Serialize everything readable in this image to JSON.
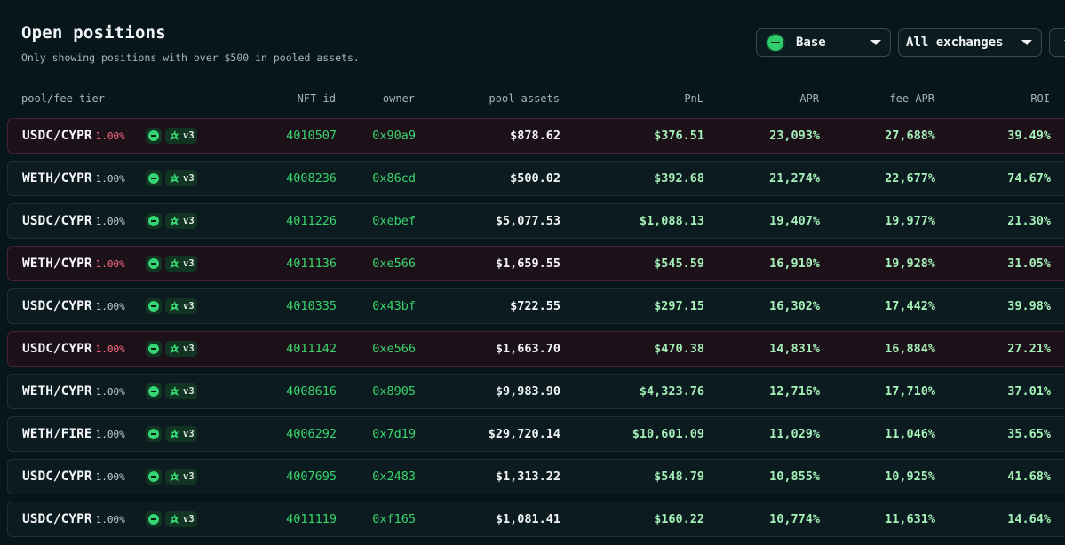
{
  "header": {
    "title": "Open positions",
    "subtitle": "Only showing positions with over $500 in pooled assets."
  },
  "filters": {
    "chain": "Base",
    "exchange": "All exchanges"
  },
  "colors": {
    "background": "#07161a",
    "accent_green": "#39d46b",
    "value_green": "#a6f0b8",
    "fee_red": "#ff6b86",
    "highlight_row": "#1d1119"
  },
  "table": {
    "columns": [
      "pool/fee tier",
      "NFT id",
      "owner",
      "pool assets",
      "PnL",
      "APR",
      "fee APR",
      "ROI"
    ],
    "rows": [
      {
        "pair": "USDC/CYPR",
        "fee": "1.00%",
        "version": "v3",
        "nft_id": "4010507",
        "owner": "0x90a9",
        "pool_assets": "$878.62",
        "pnl": "$376.51",
        "apr": "23,093%",
        "fee_apr": "27,688%",
        "roi": "39.49%",
        "highlighted": true
      },
      {
        "pair": "WETH/CYPR",
        "fee": "1.00%",
        "version": "v3",
        "nft_id": "4008236",
        "owner": "0x86cd",
        "pool_assets": "$500.02",
        "pnl": "$392.68",
        "apr": "21,274%",
        "fee_apr": "22,677%",
        "roi": "74.67%",
        "highlighted": false
      },
      {
        "pair": "USDC/CYPR",
        "fee": "1.00%",
        "version": "v3",
        "nft_id": "4011226",
        "owner": "0xebef",
        "pool_assets": "$5,077.53",
        "pnl": "$1,088.13",
        "apr": "19,407%",
        "fee_apr": "19,977%",
        "roi": "21.30%",
        "highlighted": false
      },
      {
        "pair": "WETH/CYPR",
        "fee": "1.00%",
        "version": "v3",
        "nft_id": "4011136",
        "owner": "0xe566",
        "pool_assets": "$1,659.55",
        "pnl": "$545.59",
        "apr": "16,910%",
        "fee_apr": "19,928%",
        "roi": "31.05%",
        "highlighted": true
      },
      {
        "pair": "USDC/CYPR",
        "fee": "1.00%",
        "version": "v3",
        "nft_id": "4010335",
        "owner": "0x43bf",
        "pool_assets": "$722.55",
        "pnl": "$297.15",
        "apr": "16,302%",
        "fee_apr": "17,442%",
        "roi": "39.98%",
        "highlighted": false
      },
      {
        "pair": "USDC/CYPR",
        "fee": "1.00%",
        "version": "v3",
        "nft_id": "4011142",
        "owner": "0xe566",
        "pool_assets": "$1,663.70",
        "pnl": "$470.38",
        "apr": "14,831%",
        "fee_apr": "16,884%",
        "roi": "27.21%",
        "highlighted": true
      },
      {
        "pair": "WETH/CYPR",
        "fee": "1.00%",
        "version": "v3",
        "nft_id": "4008616",
        "owner": "0x8905",
        "pool_assets": "$9,983.90",
        "pnl": "$4,323.76",
        "apr": "12,716%",
        "fee_apr": "17,710%",
        "roi": "37.01%",
        "highlighted": false
      },
      {
        "pair": "WETH/FIRE",
        "fee": "1.00%",
        "version": "v3",
        "nft_id": "4006292",
        "owner": "0x7d19",
        "pool_assets": "$29,720.14",
        "pnl": "$10,601.09",
        "apr": "11,029%",
        "fee_apr": "11,046%",
        "roi": "35.65%",
        "highlighted": false
      },
      {
        "pair": "USDC/CYPR",
        "fee": "1.00%",
        "version": "v3",
        "nft_id": "4007695",
        "owner": "0x2483",
        "pool_assets": "$1,313.22",
        "pnl": "$548.79",
        "apr": "10,855%",
        "fee_apr": "10,925%",
        "roi": "41.68%",
        "highlighted": false
      },
      {
        "pair": "USDC/CYPR",
        "fee": "1.00%",
        "version": "v3",
        "nft_id": "4011119",
        "owner": "0xf165",
        "pool_assets": "$1,081.41",
        "pnl": "$160.22",
        "apr": "10,774%",
        "fee_apr": "11,631%",
        "roi": "14.64%",
        "highlighted": false
      }
    ]
  }
}
